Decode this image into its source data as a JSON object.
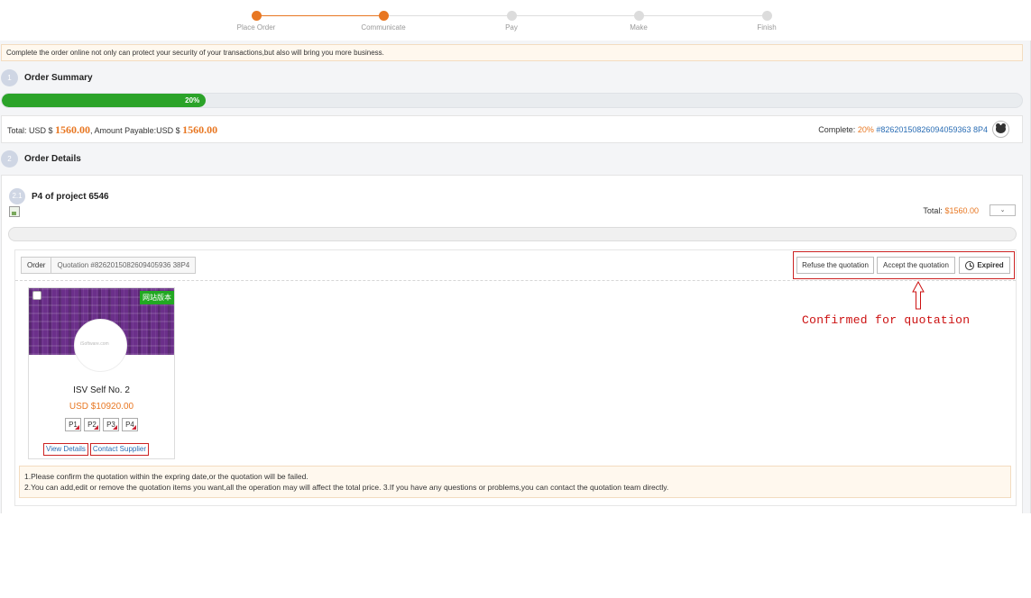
{
  "steps": [
    {
      "label": "Place Order",
      "state": "done"
    },
    {
      "label": "Communicate",
      "state": "done"
    },
    {
      "label": "Pay",
      "state": "pending"
    },
    {
      "label": "Make",
      "state": "pending"
    },
    {
      "label": "Finish",
      "state": "pending"
    }
  ],
  "notice": "Complete the order online not only can protect your security of your transactions,but also will bring you more business.",
  "summary": {
    "number": "1",
    "title": "Order Summary",
    "progress_label": "20%",
    "progress_value": 0.2,
    "total_label": "Total: USD $",
    "total_value": "1560.00",
    "payable_label": ", Amount Payable:USD $",
    "payable_value": "1560.00",
    "complete_label": "Complete:",
    "complete_pct": "20%",
    "order_id": "#82620150826094059363 8P4"
  },
  "details": {
    "number": "2",
    "title": "Order Details",
    "sub_number": "2.1",
    "sub_title": "P4 of project 6546",
    "total_label": "Total:",
    "total_value": "$1560.00",
    "dropdown_icon": "chevron-down-icon"
  },
  "quotation": {
    "crumb_order": "Order",
    "crumb_quote": "Quotation #8262015082609405936 38P4",
    "refuse_label": "Refuse the quotation",
    "accept_label": "Accept the quotation",
    "expired_label": "Expired"
  },
  "card": {
    "badge": "网站版本",
    "logo_text": "iSoftware.com",
    "name": "ISV Self No. 2",
    "price": "USD $10920.00",
    "tags": [
      "P1",
      "P2",
      "P3",
      "P4"
    ],
    "view_label": "View Details",
    "contact_label": "Contact Supplier"
  },
  "info": {
    "line1": "1.Please confirm the quotation within the expring date,or the quotation will be failed.",
    "line2": "2.You can add,edit or remove the quotation items you want,all the operation may will affect the total price. 3.If you have any questions or problems,you can contact the quotation team directly."
  },
  "annotation": "Confirmed for quotation",
  "colors": {
    "accent": "#e87722",
    "progress": "#2ba329",
    "link": "#2a6db4",
    "annotation": "#cc1111"
  }
}
